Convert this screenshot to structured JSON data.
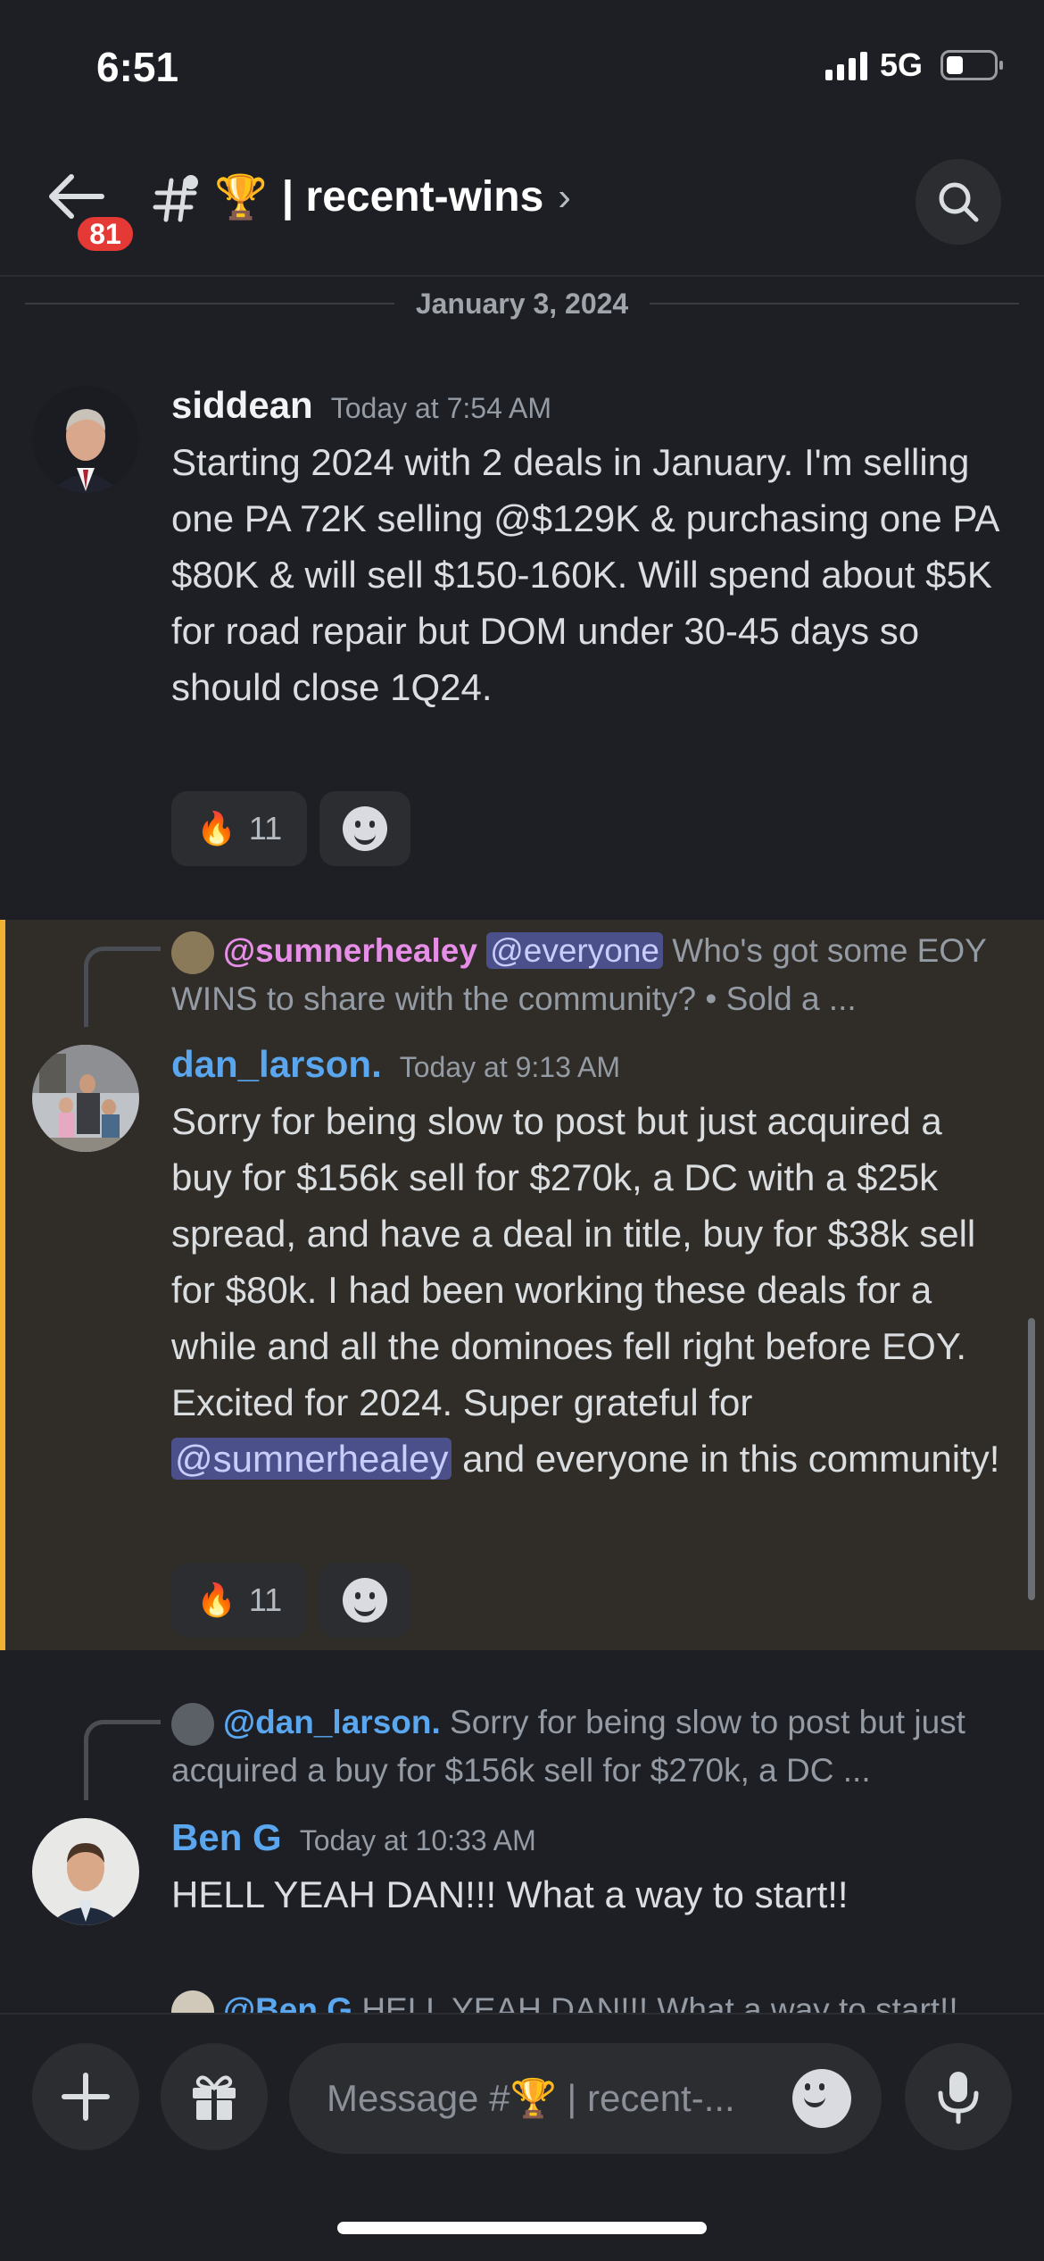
{
  "status": {
    "time": "6:51",
    "network": "5G"
  },
  "header": {
    "back_badge": "81",
    "channel_emoji": "🏆",
    "channel_name": "| recent-wins",
    "chevron": "›"
  },
  "date_divider": "January 3, 2024",
  "messages": [
    {
      "username": "siddean",
      "timestamp": "Today at 7:54 AM",
      "text": "Starting 2024 with  2 deals in January. I'm selling one PA 72K selling @$129K & purchasing one  PA $80K & will sell $150-160K. Will spend about $5K for road repair but DOM under 30-45 days so should close 1Q24.",
      "reaction_emoji": "🔥",
      "reaction_count": "11"
    },
    {
      "reply_to": "@sumnerhealey",
      "reply_mention": "@everyone",
      "reply_text": " Who's got some EOY WINS to share with the community? • Sold a ...",
      "username": "dan_larson.",
      "timestamp": "Today at 9:13 AM",
      "text_before": "Sorry for being slow to post but just acquired a buy for $156k sell for $270k, a DC with a $25k spread, and have a deal in title, buy for $38k sell for $80k. I had been working these deals for a while and all the dominoes fell right before EOY. Excited for 2024. Super grateful for ",
      "mention": "@sumnerhealey",
      "text_after": " and everyone in this community!",
      "reaction_emoji": "🔥",
      "reaction_count": "11"
    },
    {
      "reply_to": "@dan_larson.",
      "reply_text": " Sorry for being slow to post but just acquired a buy for $156k sell for $270k, a DC ...",
      "username": "Ben G",
      "timestamp": "Today at 10:33 AM",
      "text": "HELL YEAH DAN!!! What a way to start!!"
    },
    {
      "reply_to": "@Ben G",
      "reply_text": " HELL YEAH DAN!!! What a way to start!!"
    }
  ],
  "composer": {
    "placeholder": "Message #🏆 | recent-..."
  },
  "colors": {
    "accent_blue": "#5aa7f0",
    "highlight_bar": "#f0b132",
    "badge": "#e53935",
    "mention_pink": "#e78ee8"
  }
}
